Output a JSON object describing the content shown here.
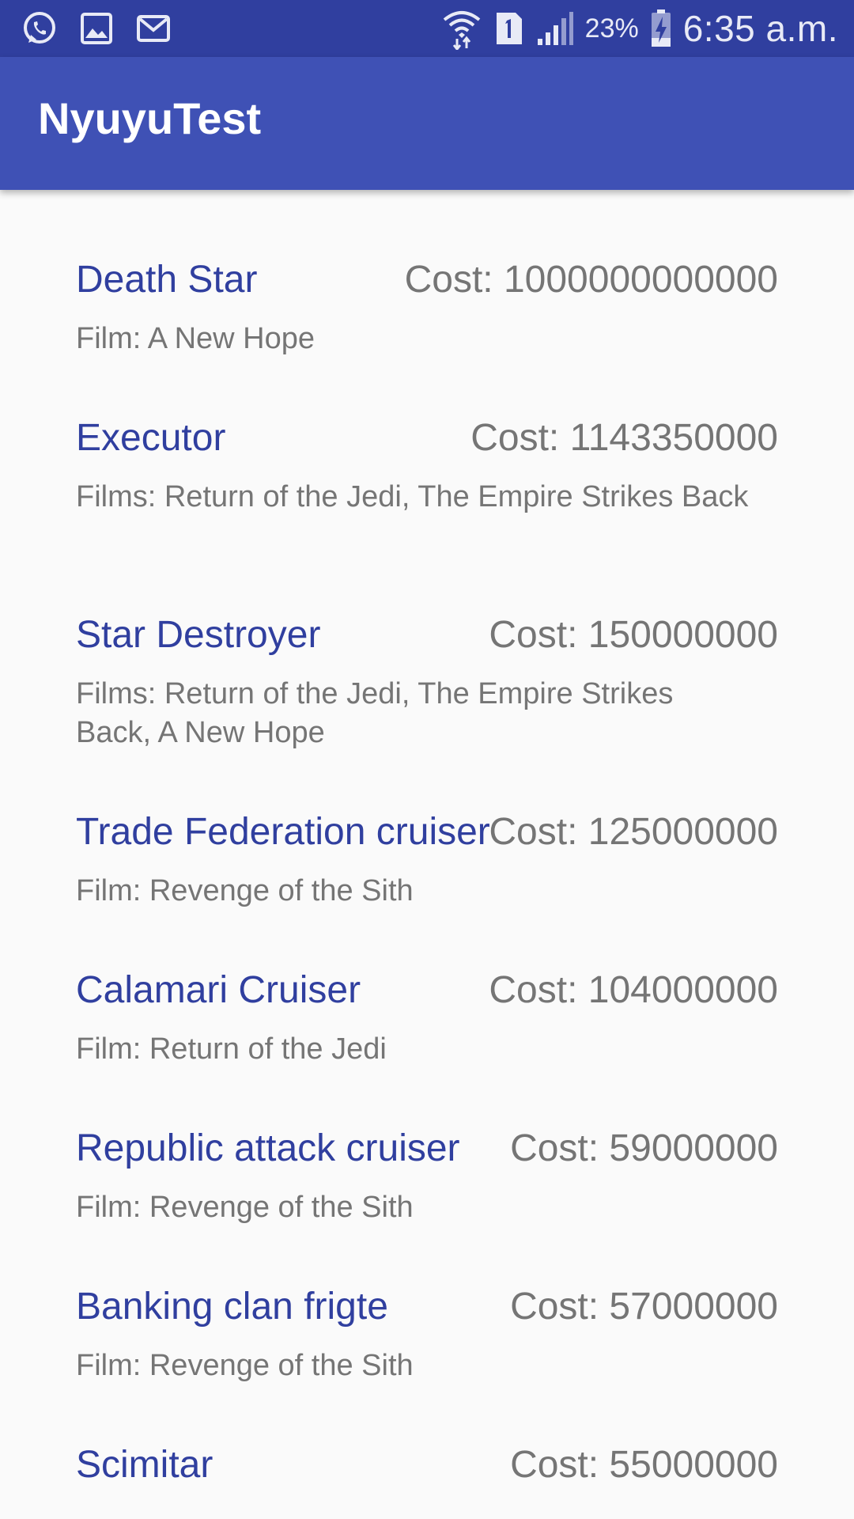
{
  "status_bar": {
    "left_icons": [
      "whatsapp-icon",
      "gallery-icon",
      "gmail-icon"
    ],
    "right_icons": [
      "wifi-icon",
      "sim-1-icon",
      "signal-icon",
      "battery-charging-icon"
    ],
    "battery_percent": "23%",
    "time": "6:35 a.m."
  },
  "app_bar": {
    "title": "NyuyuTest"
  },
  "colors": {
    "status_bar": "#303f9f",
    "app_bar": "#3f51b5",
    "item_title": "#303f9f",
    "secondary_text": "#757575",
    "background": "#fafafa"
  },
  "starships": [
    {
      "name": "Death Star",
      "cost": "Cost: 1000000000000",
      "films": "Film: A New Hope"
    },
    {
      "name": "Executor",
      "cost": "Cost: 1143350000",
      "films": "Films: Return of the Jedi, The Empire Strikes Back"
    },
    {
      "name": "Star Destroyer",
      "cost": "Cost: 150000000",
      "films": "Films: Return of the Jedi, The Empire Strikes Back, A New Hope"
    },
    {
      "name": "Trade Federation cruiser",
      "cost": "Cost: 125000000",
      "films": "Film: Revenge of the Sith"
    },
    {
      "name": "Calamari Cruiser",
      "cost": "Cost: 104000000",
      "films": "Film: Return of the Jedi"
    },
    {
      "name": "Republic attack cruiser",
      "cost": "Cost: 59000000",
      "films": "Film: Revenge of the Sith"
    },
    {
      "name": "Banking clan frigte",
      "cost": "Cost: 57000000",
      "films": "Film: Revenge of the Sith"
    },
    {
      "name": "Scimitar",
      "cost": "Cost: 55000000",
      "films": ""
    }
  ]
}
